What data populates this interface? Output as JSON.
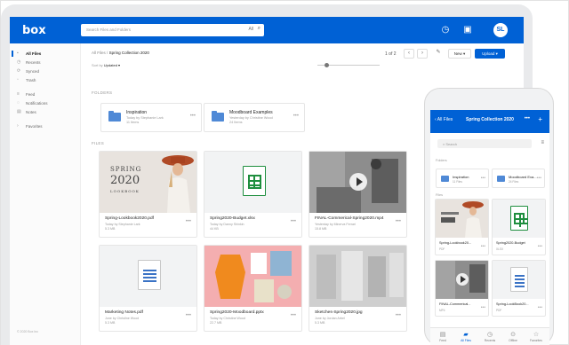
{
  "app": {
    "logo": "box",
    "search_placeholder": "Search Files and Folders",
    "search_filter": "All",
    "brand_color": "#0061d5"
  },
  "sidebar": {
    "items": [
      {
        "label": "All Files",
        "icon": "folder-icon",
        "active": true
      },
      {
        "label": "Recents",
        "icon": "clock-icon"
      },
      {
        "label": "Synced",
        "icon": "sync-icon"
      },
      {
        "label": "Trash",
        "icon": "trash-icon"
      },
      {
        "label": "Feed",
        "icon": "feed-icon"
      },
      {
        "label": "Notifications",
        "icon": "bell-icon"
      },
      {
        "label": "Notes",
        "icon": "notes-icon"
      },
      {
        "label": "Favorites",
        "icon": "star-icon"
      }
    ],
    "footer": "© 2020 Box Inc"
  },
  "main": {
    "breadcrumb": {
      "parent": "All Files",
      "separator": "/",
      "current": "Spring Collection 2020"
    },
    "sort": {
      "label": "Sort by",
      "value": "Updated"
    },
    "pager": {
      "text": "1 of 2",
      "prev": "‹",
      "next": "›"
    },
    "new_button": "New",
    "upload_button": "Upload",
    "folders_header": "FOLDERS",
    "files_header": "FILES",
    "folders": [
      {
        "name": "Inspiration",
        "owner": "Today by Stephanie Lark",
        "meta": "11 Items"
      },
      {
        "name": "Moodboard Examples",
        "owner": "Yesterday by Christine Wood",
        "meta": "24 Items"
      }
    ],
    "files": [
      {
        "name": "Spring-Lookbook2020.pdf",
        "owner": "Today by Stephanie Lark",
        "size": "5.3 MB",
        "thumb": "lookbook"
      },
      {
        "name": "Spring2020-Budget.xlsx",
        "owner": "Today by Danny Shinkin",
        "size": "44 KB",
        "thumb": "sheet"
      },
      {
        "name": "FINAL-Commerical-Spring2020.mp4",
        "owner": "Yesterday by Minerva Ferrari",
        "size": "15.8 MB",
        "thumb": "video"
      },
      {
        "name": "Marketing Notes.pdf",
        "owner": "June by Christine Wood",
        "size": "5.3 MB",
        "thumb": "doc"
      },
      {
        "name": "Spring2020-Moodboard.pptx",
        "owner": "Today by Christine Wood",
        "size": "22.7 MB",
        "thumb": "moodboard"
      },
      {
        "name": "Sketches-Spring2020.jpg",
        "owner": "June by Jordan Arbel",
        "size": "5.3 MB",
        "thumb": "sketches"
      }
    ],
    "lookbook_text": {
      "line1": "SPRING",
      "line2": "2020",
      "line3": "LOOKBOOK"
    }
  },
  "mobile": {
    "back_label": "All Files",
    "title": "Spring Collection 2020",
    "more": "•••",
    "add": "+",
    "search_placeholder": "Search",
    "folders_header": "Folders",
    "files_header": "Files",
    "folders": [
      {
        "name": "Inspiration",
        "meta": "11 Files"
      },
      {
        "name": "Moodboard Exa...",
        "meta": "24 Files"
      }
    ],
    "files": [
      {
        "name": "Spring-Lookbook20...",
        "meta": "PDF",
        "thumb": "lookbook"
      },
      {
        "name": "Spring2020-Budget",
        "meta": "XLSX",
        "thumb": "sheet"
      },
      {
        "name": "FINAL-Commerical...",
        "meta": "MP4",
        "thumb": "video"
      },
      {
        "name": "Spring-LookBook20...",
        "meta": "PDF",
        "thumb": "doc"
      }
    ],
    "tabs": [
      {
        "label": "Feed",
        "icon": "feed-icon"
      },
      {
        "label": "All Files",
        "icon": "folder-icon",
        "active": true
      },
      {
        "label": "Recents",
        "icon": "clock-icon"
      },
      {
        "label": "Offline",
        "icon": "offline-icon"
      },
      {
        "label": "Favorites",
        "icon": "star-icon"
      }
    ]
  }
}
